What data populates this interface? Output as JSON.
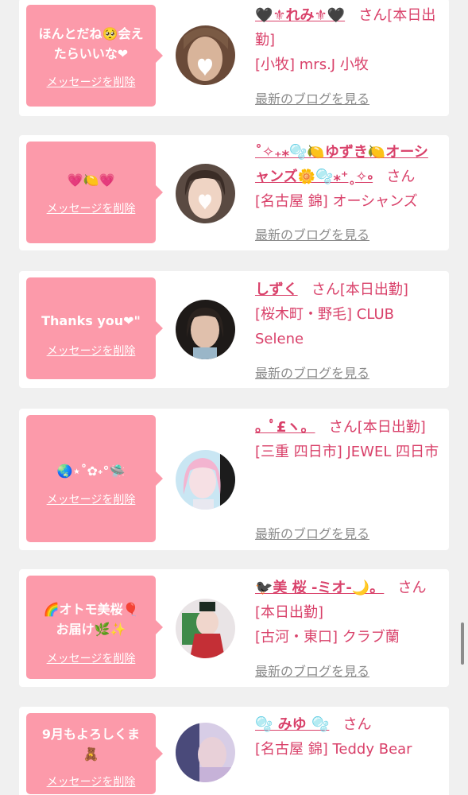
{
  "common": {
    "delete_label": "メッセージを削除",
    "blog_label": "最新のブログを見る",
    "san_label": "さん"
  },
  "cards": [
    {
      "bubble_lines": [
        "ほんとだね🥺会え",
        "たらいいな❤"
      ],
      "name": "🖤⚜れみ⚜🖤",
      "status": "[本日出勤]",
      "shop": "[小牧] mrs.J 小牧",
      "avatar_colors": [
        "#c9a98f",
        "#6a4a38"
      ]
    },
    {
      "bubble_lines": [
        "💗🍋💗"
      ],
      "name": "˚✧₊⁎🫧🍋ゆずき🍋オーシャンズ🌼🫧⁎⁺˳✧༚",
      "status": "",
      "shop": "[名古屋 錦] オーシャンズ",
      "avatar_colors": [
        "#e8c9b6",
        "#4a3a32"
      ]
    },
    {
      "bubble_lines": [
        "Thanks you❤\""
      ],
      "name": "しずく",
      "status": "[本日出勤]",
      "shop": "[桜木町・野毛] CLUB Selene",
      "avatar_colors": [
        "#d9b8a4",
        "#2e2622"
      ]
    },
    {
      "bubble_lines": [
        "🌏⋆˚✿˖°🛸"
      ],
      "name": "。ﾟ£ヽ。",
      "status": "[本日出勤]",
      "shop": "[三重 四日市] JEWEL 四日市",
      "avatar_colors": [
        "#f3c6dc",
        "#8fc7e8"
      ]
    },
    {
      "bubble_lines": [
        "🌈オトモ美桜🎈",
        "お届け🌿✨"
      ],
      "name": "🐦‍⬛美 桜 -ミオ-🌙。",
      "status": "[本日出勤]",
      "shop": "[古河・東口] クラブ蘭",
      "avatar_colors": [
        "#c93a3a",
        "#2e6a3a"
      ]
    },
    {
      "bubble_lines": [
        "9月もよろしくま",
        "🧸"
      ],
      "name": "🫧 みゆ 🫧",
      "status": "",
      "shop": "[名古屋 錦] Teddy Bear",
      "avatar_colors": [
        "#c9b4d9",
        "#3a3a6a"
      ]
    }
  ]
}
